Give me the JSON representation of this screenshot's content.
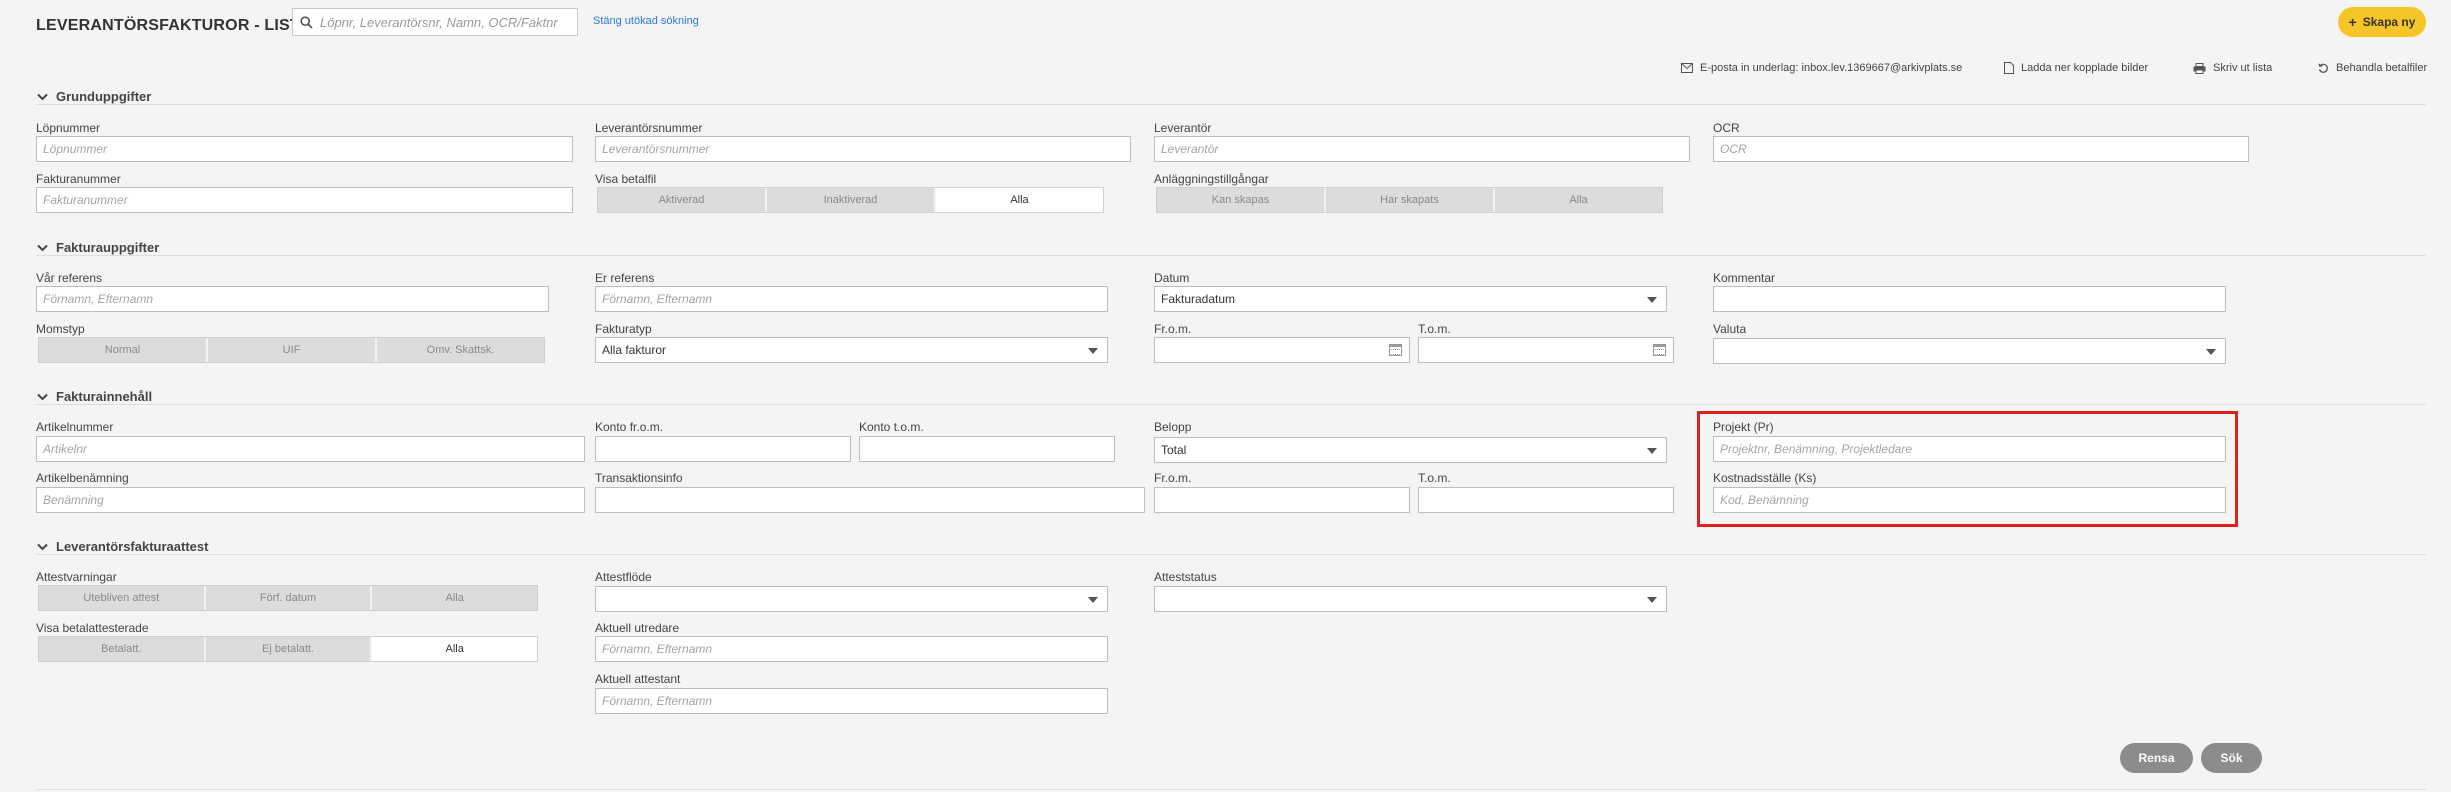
{
  "header": {
    "title": "LEVERANTÖRSFAKTUROR - LISTA",
    "search_placeholder": "Löpnr, Leverantörsnr, Namn, OCR/Faktnr",
    "close_search_link": "Stäng utökad sökning",
    "create_button": "Skapa ny"
  },
  "toolbar": {
    "email": "E-posta in underlag: inbox.lev.1369667@arkivplats.se",
    "download": "Ladda ner kopplade bilder",
    "print": "Skriv ut lista",
    "process": "Behandla betalfiler"
  },
  "sections": {
    "basic": "Grunduppgifter",
    "invoice": "Fakturauppgifter",
    "content": "Fakturainnehåll",
    "attest": "Leverantörsfakturaattest"
  },
  "basic": {
    "lopnummer_label": "Löpnummer",
    "lopnummer_ph": "Löpnummer",
    "levnr_label": "Leverantörsnummer",
    "levnr_ph": "Leverantörsnummer",
    "lev_label": "Leverantör",
    "lev_ph": "Leverantör",
    "ocr_label": "OCR",
    "ocr_ph": "OCR",
    "faktnr_label": "Fakturanummer",
    "faktnr_ph": "Fakturanummer",
    "betalfil_label": "Visa betalfil",
    "betalfil_options": [
      "Aktiverad",
      "Inaktiverad",
      "Alla"
    ],
    "anl_label": "Anläggningstillgångar",
    "anl_options": [
      "Kan skapas",
      "Har skapats",
      "Alla"
    ]
  },
  "invoice": {
    "var_ref_label": "Vår referens",
    "var_ref_ph": "Förnamn, Efternamn",
    "er_ref_label": "Er referens",
    "er_ref_ph": "Förnamn, Efternamn",
    "datum_label": "Datum",
    "datum_value": "Fakturadatum",
    "kommentar_label": "Kommentar",
    "momstyp_label": "Momstyp",
    "momstyp_options": [
      "Normal",
      "UIF",
      "Omv. Skattsk."
    ],
    "fakturatyp_label": "Fakturatyp",
    "fakturatyp_value": "Alla fakturor",
    "from_label": "Fr.o.m.",
    "tom_label": "T.o.m.",
    "valuta_label": "Valuta"
  },
  "content": {
    "artnr_label": "Artikelnummer",
    "artnr_ph": "Artikelnr",
    "konto_from_label": "Konto fr.o.m.",
    "konto_tom_label": "Konto t.o.m.",
    "belopp_label": "Belopp",
    "belopp_value": "Total",
    "projekt_label": "Projekt (Pr)",
    "projekt_ph": "Projektnr, Benämning, Projektledare",
    "artben_label": "Artikelbenämning",
    "artben_ph": "Benämning",
    "transinfo_label": "Transaktionsinfo",
    "from_label": "Fr.o.m.",
    "tom_label": "T.o.m.",
    "ks_label": "Kostnadsställe (Ks)",
    "ks_ph": "Kod, Benämning"
  },
  "attest": {
    "varningar_label": "Attestvarningar",
    "varningar_options": [
      "Utebliven attest",
      "Förf. datum",
      "Alla"
    ],
    "flode_label": "Attestflöde",
    "status_label": "Atteststatus",
    "betalatt_label": "Visa betalattesterade",
    "betalatt_options": [
      "Betalatt.",
      "Ej betalatt.",
      "Alla"
    ],
    "utredare_label": "Aktuell utredare",
    "utredare_ph": "Förnamn, Efternamn",
    "attestant_label": "Aktuell attestant",
    "attestant_ph": "Förnamn, Efternamn"
  },
  "actions": {
    "clear": "Rensa",
    "search": "Sök"
  },
  "colors": {
    "accent": "#f6c628",
    "highlight": "#e0201e",
    "link": "#2a7bd5"
  }
}
